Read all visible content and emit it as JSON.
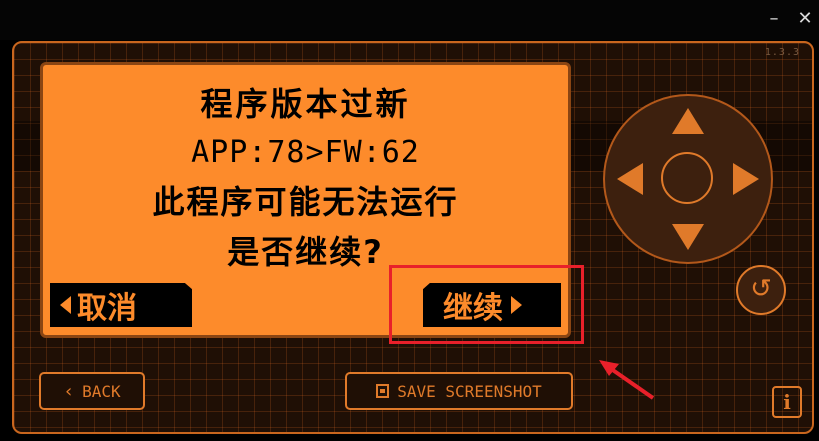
{
  "window": {
    "minimize_label": "–",
    "close_label": "✕"
  },
  "device": {
    "version": "1.3.3"
  },
  "screen": {
    "title": "程序版本过新",
    "version_line": "APP:78>FW:62",
    "warning": "此程序可能无法运行",
    "question": "是否继续?",
    "cancel_label": "取消",
    "continue_label": "继续"
  },
  "controls": {
    "back_label": "BACK",
    "save_screenshot_label": "SAVE SCREENSHOT",
    "info_label": "i",
    "undo_label": "↺"
  },
  "icons": {
    "back": "chevron-left-icon",
    "save": "camera-icon",
    "undo": "undo-icon",
    "info": "info-icon"
  },
  "colors": {
    "accent": "#fd8b2b",
    "outline": "#e07a2a",
    "highlight": "#e8202a",
    "background": "#1f0f05"
  }
}
